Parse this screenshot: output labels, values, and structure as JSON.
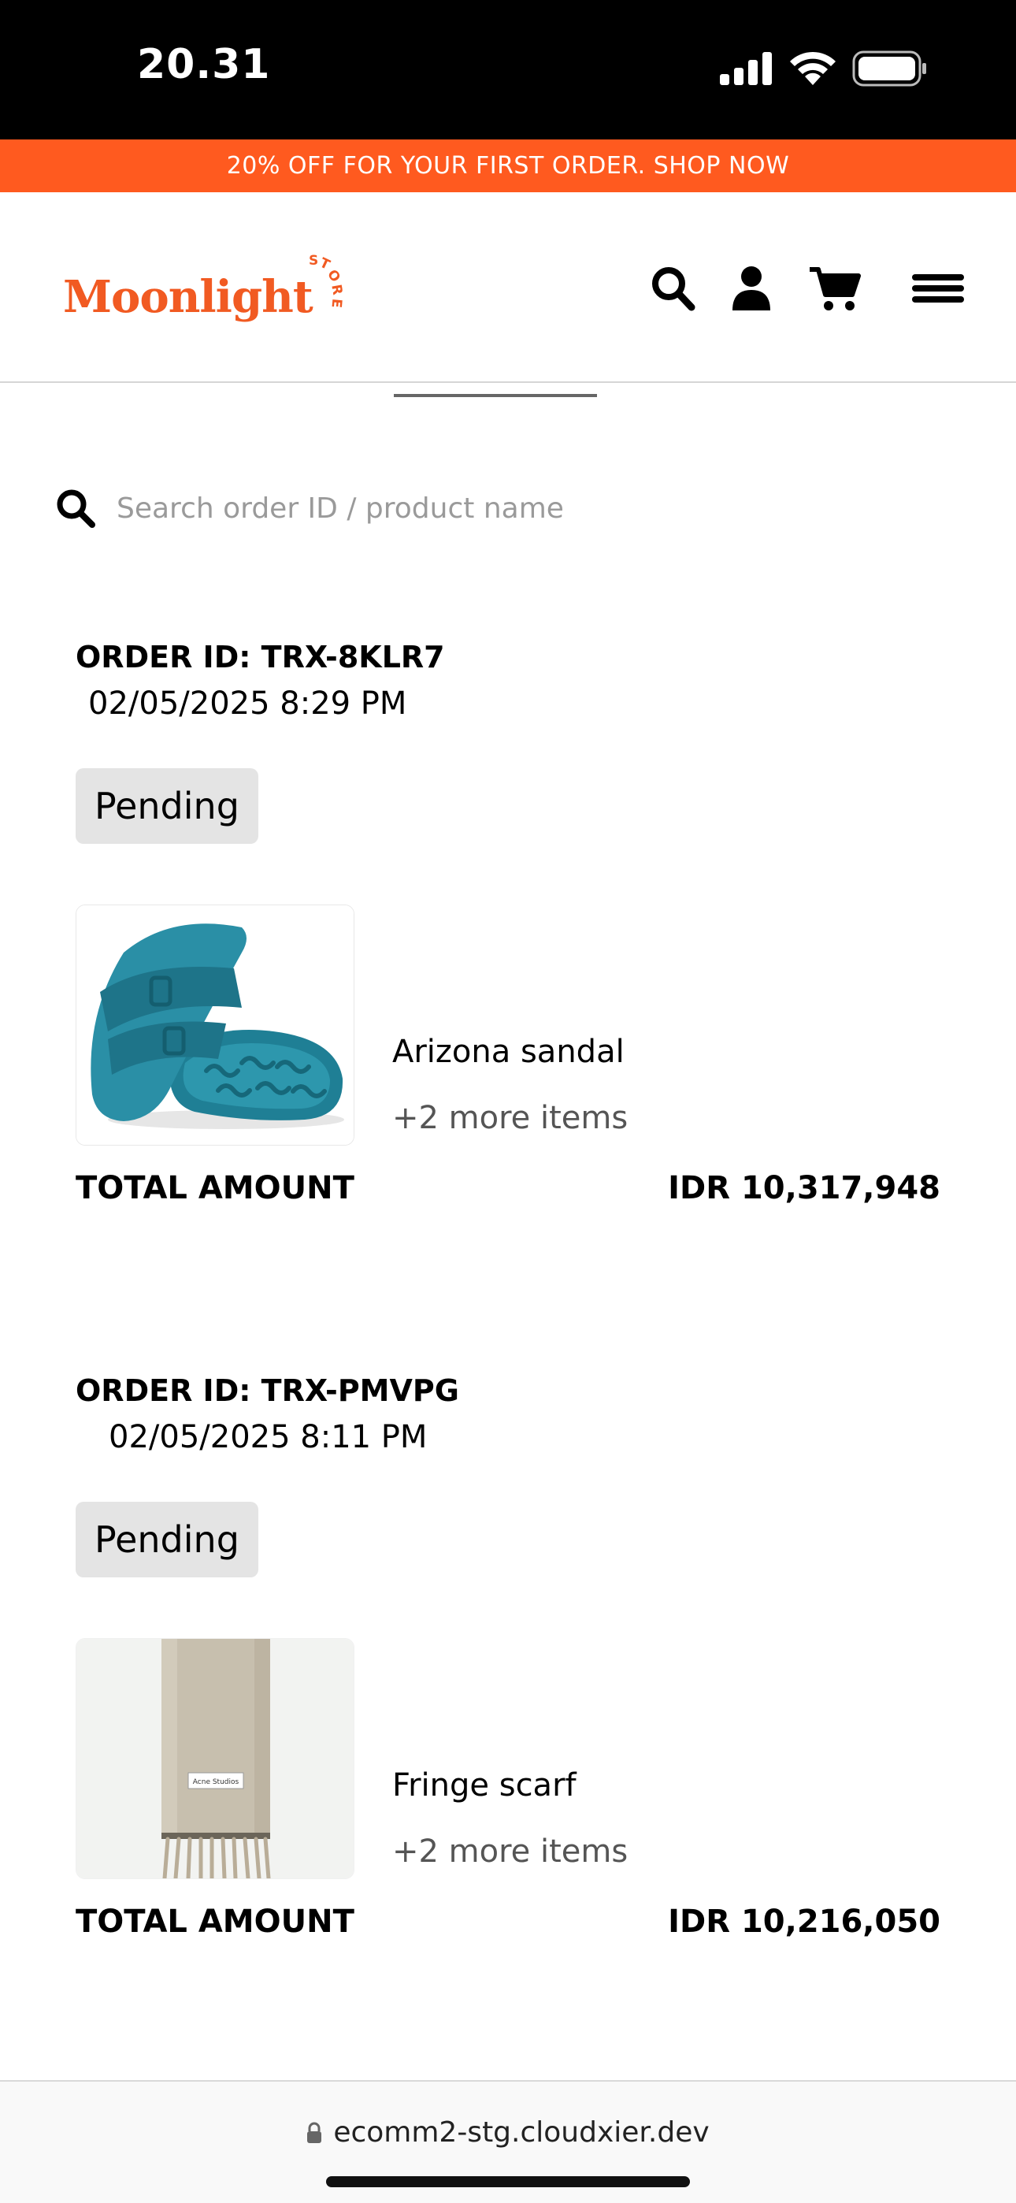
{
  "status_bar": {
    "time": "20.31"
  },
  "promo": {
    "text": "20% OFF FOR YOUR FIRST ORDER. SHOP NOW"
  },
  "header": {
    "logo_text": "Moonlight",
    "logo_badge": "STORE",
    "brand_color": "#f15a22",
    "icons": [
      "search-icon",
      "user-icon",
      "cart-icon",
      "menu-icon"
    ]
  },
  "search": {
    "placeholder": "Search order ID / product name",
    "value": ""
  },
  "orders": [
    {
      "id_label": "ORDER ID: TRX-8KLR7",
      "date": "02/05/2025 8:29 PM",
      "status": "Pending",
      "product_name": "Arizona sandal",
      "more_items": "+2 more items",
      "total_label": "TOTAL AMOUNT",
      "total_value": "IDR 10,317,948"
    },
    {
      "id_label": "ORDER ID: TRX-PMVPG",
      "date": "02/05/2025 8:11 PM",
      "status": "Pending",
      "product_name": "Fringe scarf",
      "more_items": "+2 more items",
      "total_label": "TOTAL AMOUNT",
      "total_value": "IDR 10,216,050",
      "product_image_label": "Acne Studios"
    }
  ],
  "browser": {
    "url": "ecomm2-stg.cloudxier.dev"
  },
  "colors": {
    "promo_bg": "#ff5a1f",
    "badge_bg": "#e4e4e4"
  }
}
